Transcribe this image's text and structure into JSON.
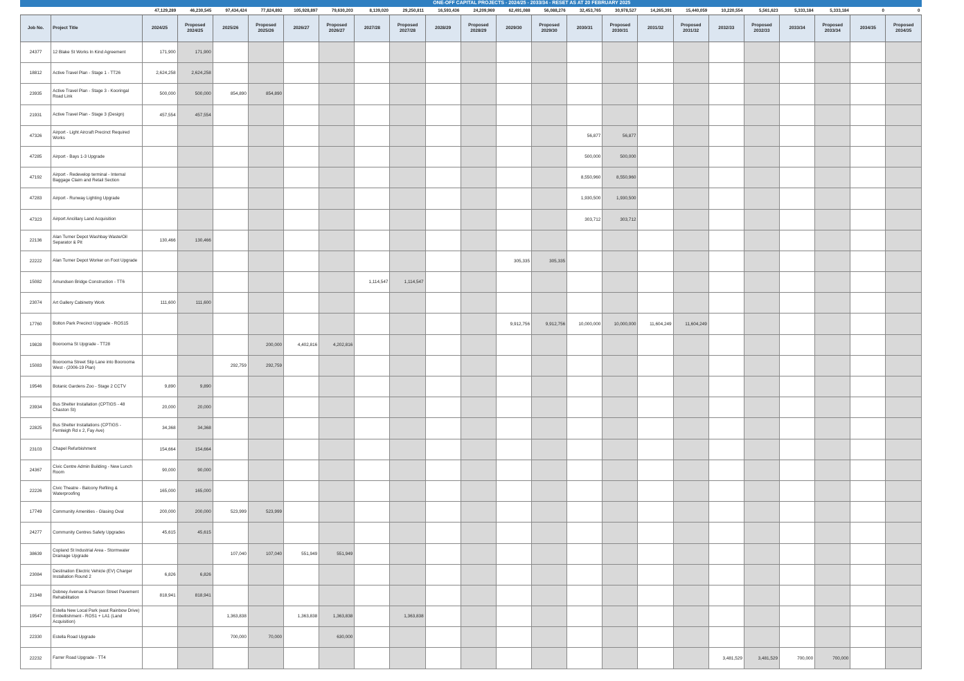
{
  "banner": "ONE-OFF CAPITAL PROJECTS - 2024/25 - 2033/34 - RESET AS AT 20 FEBRUARY 2025",
  "headers": {
    "job_no": "Job No.",
    "project_title": "Project Title",
    "years": [
      "2024/25",
      "Proposed 2024/25",
      "2025/26",
      "Proposed 2025/26",
      "2026/27",
      "Proposed 2026/27",
      "2027/28",
      "Proposed 2027/28",
      "2028/29",
      "Proposed 2028/29",
      "2029/30",
      "Proposed 2029/30",
      "2030/31",
      "Proposed 2030/31",
      "2031/32",
      "Proposed 2031/32",
      "2032/33",
      "Proposed 2032/33",
      "2033/34",
      "Proposed 2033/34",
      "2034/35",
      "Proposed 2034/35"
    ]
  },
  "totals": [
    "47,129,289",
    "46,230,545",
    "97,434,424",
    "77,824,892",
    "105,928,897",
    "79,630,203",
    "8,139,020",
    "29,250,811",
    "16,593,436",
    "24,209,969",
    "62,491,088",
    "56,088,276",
    "32,453,765",
    "30,978,527",
    "14,265,391",
    "15,440,059",
    "10,220,554",
    "5,561,623",
    "5,333,184",
    "5,333,184",
    "0",
    "0"
  ],
  "rows": [
    {
      "job": "24377",
      "title": "12 Blake St Works In Kind Agreement",
      "v": [
        "171,900",
        "171,900",
        "",
        "",
        "",
        "",
        "",
        "",
        "",
        "",
        "",
        "",
        "",
        "",
        "",
        "",
        "",
        "",
        "",
        "",
        "",
        ""
      ]
    },
    {
      "job": "18812",
      "title": "Active Travel Plan - Stage 1 - TT26",
      "v": [
        "2,624,258",
        "2,624,258",
        "",
        "",
        "",
        "",
        "",
        "",
        "",
        "",
        "",
        "",
        "",
        "",
        "",
        "",
        "",
        "",
        "",
        "",
        "",
        ""
      ]
    },
    {
      "job": "23935",
      "title": "Active Travel Plan - Stage 3 - Kooringal Road Link",
      "v": [
        "500,000",
        "500,000",
        "854,890",
        "854,890",
        "",
        "",
        "",
        "",
        "",
        "",
        "",
        "",
        "",
        "",
        "",
        "",
        "",
        "",
        "",
        "",
        "",
        ""
      ]
    },
    {
      "job": "21931",
      "title": "Active Travel Plan - Stage 3 (Design)",
      "v": [
        "457,554",
        "457,554",
        "",
        "",
        "",
        "",
        "",
        "",
        "",
        "",
        "",
        "",
        "",
        "",
        "",
        "",
        "",
        "",
        "",
        "",
        "",
        ""
      ]
    },
    {
      "job": "47326",
      "title": "Airport - Light Aircraft Precinct Required Works",
      "v": [
        "",
        "",
        "",
        "",
        "",
        "",
        "",
        "",
        "",
        "",
        "",
        "",
        "56,877",
        "56,877",
        "",
        "",
        "",
        "",
        "",
        "",
        "",
        ""
      ]
    },
    {
      "job": "47285",
      "title": "Airport - Bays 1-3 Upgrade",
      "v": [
        "",
        "",
        "",
        "",
        "",
        "",
        "",
        "",
        "",
        "",
        "",
        "",
        "500,000",
        "500,000",
        "",
        "",
        "",
        "",
        "",
        "",
        "",
        ""
      ]
    },
    {
      "job": "47192",
      "title": "Airport - Redevelop terminal - Internal Baggage Claim and Retail Section",
      "v": [
        "",
        "",
        "",
        "",
        "",
        "",
        "",
        "",
        "",
        "",
        "",
        "",
        "8,550,960",
        "8,550,960",
        "",
        "",
        "",
        "",
        "",
        "",
        "",
        ""
      ]
    },
    {
      "job": "47283",
      "title": "Airport - Runway Lighting Upgrade",
      "v": [
        "",
        "",
        "",
        "",
        "",
        "",
        "",
        "",
        "",
        "",
        "",
        "",
        "1,930,500",
        "1,930,500",
        "",
        "",
        "",
        "",
        "",
        "",
        "",
        ""
      ]
    },
    {
      "job": "47323",
      "title": "Airport Ancillary Land Acquisition",
      "v": [
        "",
        "",
        "",
        "",
        "",
        "",
        "",
        "",
        "",
        "",
        "",
        "",
        "303,712",
        "303,712",
        "",
        "",
        "",
        "",
        "",
        "",
        "",
        ""
      ]
    },
    {
      "job": "22136",
      "title": "Alan Turner Depot Washbay Waste/Oil Separator & Pit",
      "v": [
        "130,466",
        "130,466",
        "",
        "",
        "",
        "",
        "",
        "",
        "",
        "",
        "",
        "",
        "",
        "",
        "",
        "",
        "",
        "",
        "",
        "",
        "",
        ""
      ]
    },
    {
      "job": "22222",
      "title": "Alan Turner Depot Worker on Foot Upgrade",
      "v": [
        "",
        "",
        "",
        "",
        "",
        "",
        "",
        "",
        "",
        "",
        "305,335",
        "305,335",
        "",
        "",
        "",
        "",
        "",
        "",
        "",
        "",
        "",
        ""
      ]
    },
    {
      "job": "15082",
      "title": "Amundsen Bridge Construction - TT6",
      "v": [
        "",
        "",
        "",
        "",
        "",
        "",
        "1,114,547",
        "1,114,547",
        "",
        "",
        "",
        "",
        "",
        "",
        "",
        "",
        "",
        "",
        "",
        "",
        "",
        ""
      ]
    },
    {
      "job": "23074",
      "title": "Art Gallery Cabinetry Work",
      "v": [
        "111,600",
        "111,600",
        "",
        "",
        "",
        "",
        "",
        "",
        "",
        "",
        "",
        "",
        "",
        "",
        "",
        "",
        "",
        "",
        "",
        "",
        "",
        ""
      ]
    },
    {
      "job": "17760",
      "title": "Bolton Park Precinct Upgrade - ROS15",
      "v": [
        "",
        "",
        "",
        "",
        "",
        "",
        "",
        "",
        "",
        "",
        "9,912,756",
        "9,912,756",
        "10,000,000",
        "10,000,000",
        "11,604,249",
        "11,604,249",
        "",
        "",
        "",
        "",
        "",
        ""
      ]
    },
    {
      "job": "19828",
      "title": "Boorooma St Upgrade - TT28",
      "v": [
        "",
        "",
        "",
        "200,000",
        "4,402,816",
        "4,202,816",
        "",
        "",
        "",
        "",
        "",
        "",
        "",
        "",
        "",
        "",
        "",
        "",
        "",
        "",
        "",
        ""
      ]
    },
    {
      "job": "15083",
      "title": "Boorooma Street Slip Lane into Boorooma West - (2006-19 Plan)",
      "v": [
        "",
        "",
        "292,759",
        "292,759",
        "",
        "",
        "",
        "",
        "",
        "",
        "",
        "",
        "",
        "",
        "",
        "",
        "",
        "",
        "",
        "",
        "",
        ""
      ]
    },
    {
      "job": "19546",
      "title": "Botanic Gardens Zoo - Stage 2 CCTV",
      "v": [
        "9,890",
        "9,890",
        "",
        "",
        "",
        "",
        "",
        "",
        "",
        "",
        "",
        "",
        "",
        "",
        "",
        "",
        "",
        "",
        "",
        "",
        "",
        ""
      ]
    },
    {
      "job": "23934",
      "title": "Bus Shelter Installation (CPTIGS - 48 Chaston St)",
      "v": [
        "20,000",
        "20,000",
        "",
        "",
        "",
        "",
        "",
        "",
        "",
        "",
        "",
        "",
        "",
        "",
        "",
        "",
        "",
        "",
        "",
        "",
        "",
        ""
      ]
    },
    {
      "job": "22825",
      "title": "Bus Shelter Installations (CPTIGS - Fernleigh Rd x 2, Fay Ave)",
      "v": [
        "34,368",
        "34,368",
        "",
        "",
        "",
        "",
        "",
        "",
        "",
        "",
        "",
        "",
        "",
        "",
        "",
        "",
        "",
        "",
        "",
        "",
        "",
        ""
      ]
    },
    {
      "job": "23103",
      "title": "Chapel Refurbishment",
      "v": [
        "154,664",
        "154,664",
        "",
        "",
        "",
        "",
        "",
        "",
        "",
        "",
        "",
        "",
        "",
        "",
        "",
        "",
        "",
        "",
        "",
        "",
        "",
        ""
      ]
    },
    {
      "job": "24367",
      "title": "Civic Centre Admin Building - New Lunch Room",
      "v": [
        "90,000",
        "90,000",
        "",
        "",
        "",
        "",
        "",
        "",
        "",
        "",
        "",
        "",
        "",
        "",
        "",
        "",
        "",
        "",
        "",
        "",
        "",
        ""
      ]
    },
    {
      "job": "22226",
      "title": "Civic Theatre - Balcony Refiling & Waterproofing",
      "v": [
        "165,000",
        "165,000",
        "",
        "",
        "",
        "",
        "",
        "",
        "",
        "",
        "",
        "",
        "",
        "",
        "",
        "",
        "",
        "",
        "",
        "",
        "",
        ""
      ]
    },
    {
      "job": "17749",
      "title": "Community Amenities - Glasing Oval",
      "v": [
        "200,000",
        "200,000",
        "523,999",
        "523,999",
        "",
        "",
        "",
        "",
        "",
        "",
        "",
        "",
        "",
        "",
        "",
        "",
        "",
        "",
        "",
        "",
        "",
        ""
      ]
    },
    {
      "job": "24277",
      "title": "Community Centres Safety Upgrades",
      "v": [
        "45,615",
        "45,615",
        "",
        "",
        "",
        "",
        "",
        "",
        "",
        "",
        "",
        "",
        "",
        "",
        "",
        "",
        "",
        "",
        "",
        "",
        "",
        ""
      ]
    },
    {
      "job": "38639",
      "title": "Copland St Industrial Area - Stormwater Drainage Upgrade",
      "v": [
        "",
        "",
        "107,040",
        "107,040",
        "551,949",
        "551,949",
        "",
        "",
        "",
        "",
        "",
        "",
        "",
        "",
        "",
        "",
        "",
        "",
        "",
        "",
        "",
        ""
      ]
    },
    {
      "job": "23084",
      "title": "Destination Electric Vehicle (EV) Charger Installation Round 2",
      "v": [
        "6,826",
        "6,826",
        "",
        "",
        "",
        "",
        "",
        "",
        "",
        "",
        "",
        "",
        "",
        "",
        "",
        "",
        "",
        "",
        "",
        "",
        "",
        ""
      ]
    },
    {
      "job": "21348",
      "title": "Dobney Avenue & Pearson Street Pavement Rehabilitation",
      "v": [
        "818,941",
        "818,941",
        "",
        "",
        "",
        "",
        "",
        "",
        "",
        "",
        "",
        "",
        "",
        "",
        "",
        "",
        "",
        "",
        "",
        "",
        "",
        ""
      ]
    },
    {
      "job": "19547",
      "title": "Estella New Local Park (east Rainbow Drive) Embellishment - ROS1 + LA1 (Land Acquisition)",
      "v": [
        "",
        "",
        "1,363,838",
        "",
        "1,363,838",
        "1,363,838",
        "",
        "1,363,838",
        "",
        "",
        "",
        "",
        "",
        "",
        "",
        "",
        "",
        "",
        "",
        "",
        "",
        ""
      ]
    },
    {
      "job": "22330",
      "title": "Estella Road Upgrade",
      "v": [
        "",
        "",
        "700,000",
        "70,000",
        "",
        "630,000",
        "",
        "",
        "",
        "",
        "",
        "",
        "",
        "",
        "",
        "",
        "",
        "",
        "",
        "",
        "",
        ""
      ]
    },
    {
      "job": "22232",
      "title": "Farrer Road Upgrade - TT4",
      "v": [
        "",
        "",
        "",
        "",
        "",
        "",
        "",
        "",
        "",
        "",
        "",
        "",
        "",
        "",
        "",
        "",
        "3,481,529",
        "3,481,529",
        "700,000",
        "700,000",
        "",
        ""
      ]
    }
  ]
}
